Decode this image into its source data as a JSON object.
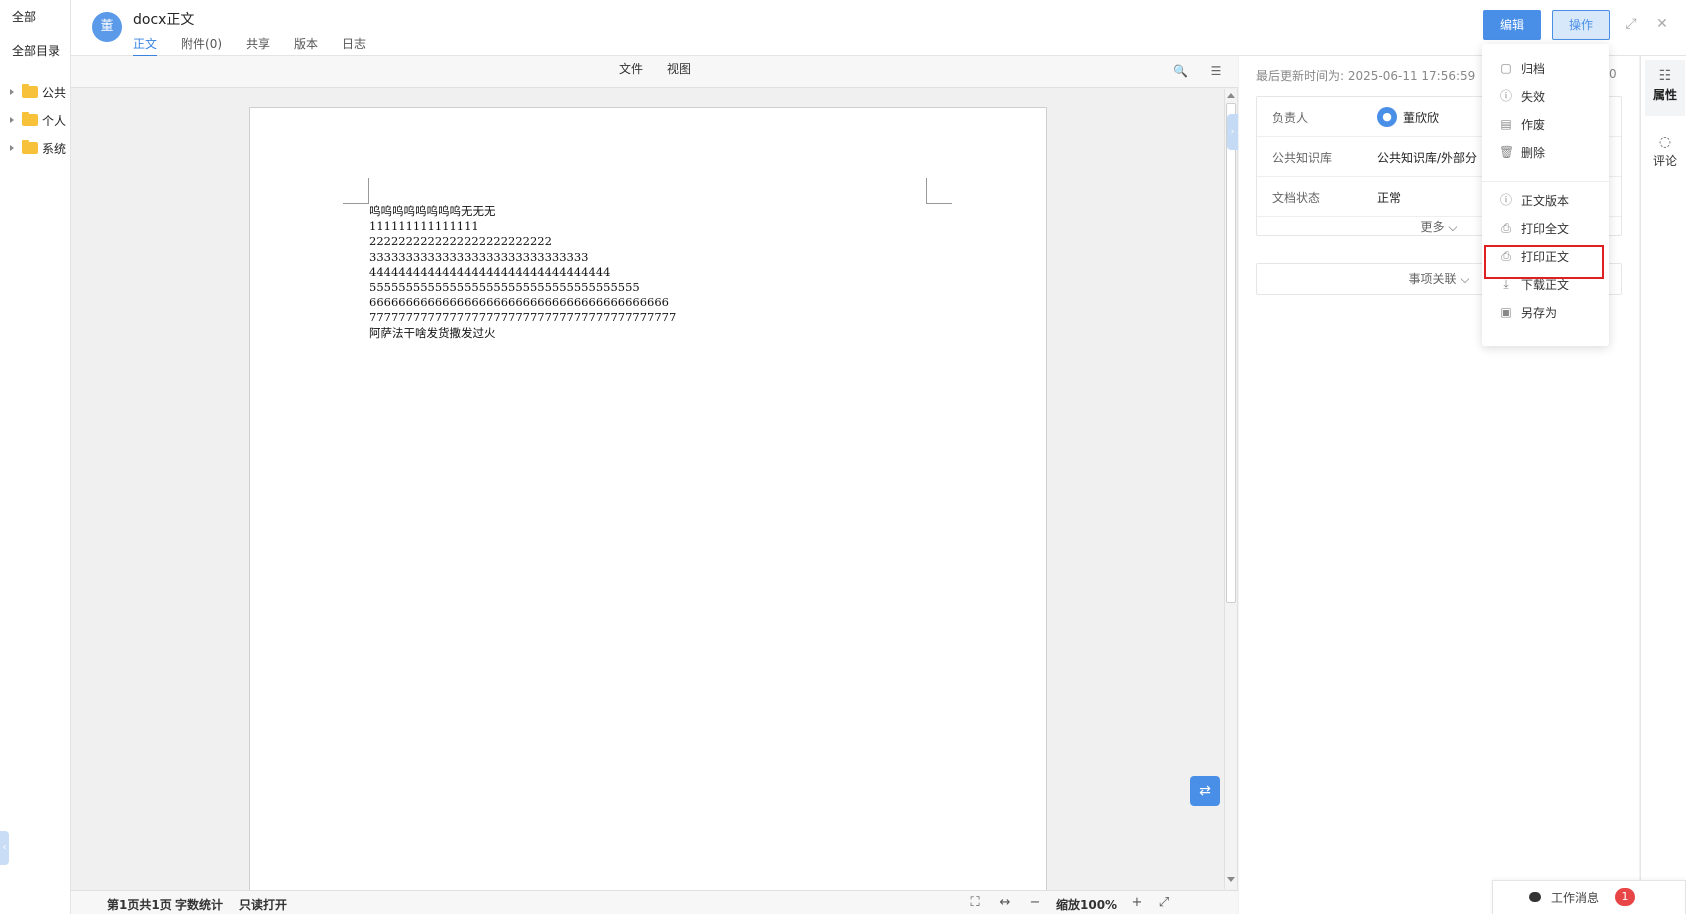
{
  "sidebar": {
    "all_label": "全部",
    "dir_label": "全部目录",
    "tree": [
      "公共",
      "个人",
      "系统"
    ]
  },
  "header": {
    "avatar_char": "董",
    "title": "docx正文",
    "tabs": [
      "正文",
      "附件(0)",
      "共享",
      "版本",
      "日志"
    ],
    "active_tab": "正文",
    "edit_label": "编辑",
    "operation_label": "操作"
  },
  "viewer": {
    "menus": [
      "文件",
      "视图"
    ],
    "lines": [
      "呜呜呜呜呜呜呜呜无无无",
      "111111111111111",
      "2222222222222222222222222",
      "333333333333333333333333333333",
      "444444444444444444444444444444444",
      "5555555555555555555555555555555555555",
      "66666666666666666666666666666666666666666",
      "777777777777777777777777777777777777777777",
      "阿萨法干啥发货撒发过火"
    ],
    "status": {
      "page_info": "第1页共1页",
      "word_count": "字数统计",
      "read_only": "只读打开",
      "zoom": "缩放100%"
    }
  },
  "properties": {
    "last_updated_label": "最后更新时间为: 2025-06-11 17:56:59",
    "counter": "0",
    "rows": [
      {
        "label": "负责人",
        "value": "董欣欣"
      },
      {
        "label": "公共知识库",
        "value": "公共知识库/外部分"
      },
      {
        "label": "文档状态",
        "value": "正常"
      }
    ],
    "more_label": "更多",
    "related_label": "事项关联"
  },
  "vtabs": [
    {
      "label": "属性",
      "icon": "sliders-icon"
    },
    {
      "label": "评论",
      "icon": "comment-icon"
    }
  ],
  "work_message": {
    "label": "工作消息",
    "count": "1"
  },
  "dropdown": {
    "items": [
      {
        "label": "归档",
        "icon": "archive-icon"
      },
      {
        "label": "失效",
        "icon": "info-icon"
      },
      {
        "label": "作废",
        "icon": "void-icon"
      },
      {
        "label": "删除",
        "icon": "trash-icon"
      },
      {
        "label": "正文版本",
        "icon": "info-icon"
      },
      {
        "label": "打印全文",
        "icon": "printer-icon"
      },
      {
        "label": "打印正文",
        "icon": "printer-icon"
      },
      {
        "label": "下载正文",
        "icon": "download-icon"
      },
      {
        "label": "另存为",
        "icon": "save-icon"
      }
    ],
    "highlighted": "打印正文"
  },
  "colors": {
    "accent": "#4a8fe7",
    "highlight": "#e02020",
    "folder": "#f7c23a",
    "badge": "#e84646"
  }
}
